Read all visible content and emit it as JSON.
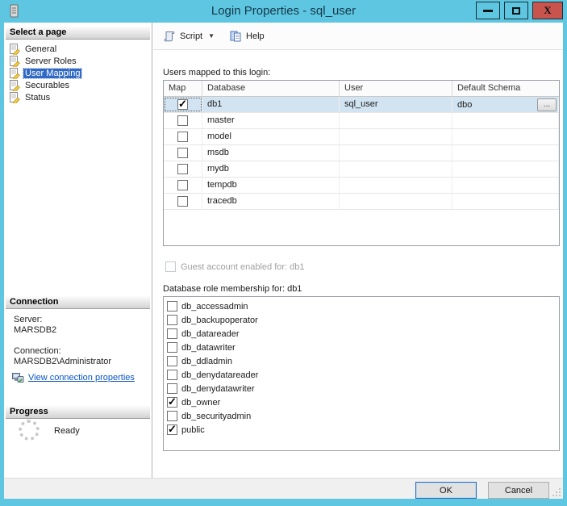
{
  "window": {
    "title": "Login Properties - sql_user",
    "close_glyph": "X"
  },
  "sidebar": {
    "select_page_header": "Select a page",
    "pages": [
      {
        "label": "General",
        "selected": false
      },
      {
        "label": "Server Roles",
        "selected": false
      },
      {
        "label": "User Mapping",
        "selected": true
      },
      {
        "label": "Securables",
        "selected": false
      },
      {
        "label": "Status",
        "selected": false
      }
    ],
    "connection_header": "Connection",
    "server_label": "Server:",
    "server_value": "MARSDB2",
    "connection_label": "Connection:",
    "connection_value": "MARSDB2\\Administrator",
    "view_link": "View connection properties",
    "progress_header": "Progress",
    "progress_status": "Ready"
  },
  "toolbar": {
    "script_label": "Script",
    "help_label": "Help"
  },
  "mapping": {
    "users_label": "Users mapped to this login:",
    "columns": [
      "Map",
      "Database",
      "User",
      "Default Schema"
    ],
    "browse_label": "...",
    "rows": [
      {
        "map": true,
        "database": "db1",
        "user": "sql_user",
        "schema": "dbo",
        "selected": true
      },
      {
        "map": false,
        "database": "master",
        "user": "",
        "schema": "",
        "selected": false
      },
      {
        "map": false,
        "database": "model",
        "user": "",
        "schema": "",
        "selected": false
      },
      {
        "map": false,
        "database": "msdb",
        "user": "",
        "schema": "",
        "selected": false
      },
      {
        "map": false,
        "database": "mydb",
        "user": "",
        "schema": "",
        "selected": false
      },
      {
        "map": false,
        "database": "tempdb",
        "user": "",
        "schema": "",
        "selected": false
      },
      {
        "map": false,
        "database": "tracedb",
        "user": "",
        "schema": "",
        "selected": false
      }
    ],
    "guest_label": "Guest account enabled for: db1",
    "guest_checked": false,
    "roles_label": "Database role membership for: db1",
    "roles": [
      {
        "name": "db_accessadmin",
        "checked": false
      },
      {
        "name": "db_backupoperator",
        "checked": false
      },
      {
        "name": "db_datareader",
        "checked": false
      },
      {
        "name": "db_datawriter",
        "checked": false
      },
      {
        "name": "db_ddladmin",
        "checked": false
      },
      {
        "name": "db_denydatareader",
        "checked": false
      },
      {
        "name": "db_denydatawriter",
        "checked": false
      },
      {
        "name": "db_owner",
        "checked": true
      },
      {
        "name": "db_securityadmin",
        "checked": false
      },
      {
        "name": "public",
        "checked": true
      }
    ]
  },
  "footer": {
    "ok_label": "OK",
    "cancel_label": "Cancel"
  },
  "colors": {
    "titlebar": "#5ec6e0",
    "close_button": "#c9544e",
    "selection_blue": "#316ac5",
    "selected_row": "#d2e4f1",
    "link": "#0a55c4"
  }
}
